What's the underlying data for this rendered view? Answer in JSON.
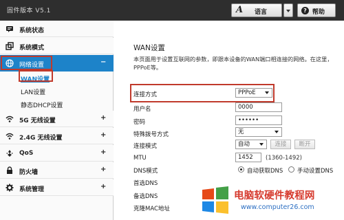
{
  "header": {
    "firmware_version": "固件版本 V5.1",
    "language_glyph": "A",
    "language_label": "语言",
    "help_label": "帮助"
  },
  "sidebar": {
    "items": [
      {
        "label": "系统状态",
        "icon": "status-icon"
      },
      {
        "label": "系统模式",
        "icon": "mode-icon"
      },
      {
        "label": "网络设置",
        "icon": "globe-icon",
        "toggle": "−"
      },
      {
        "label": "5G 无线设置",
        "icon": "wifi-icon",
        "toggle": "+"
      },
      {
        "label": "2.4G 无线设置",
        "icon": "wifi-icon",
        "toggle": "+"
      },
      {
        "label": "QoS",
        "icon": "qos-icon",
        "toggle": "+"
      },
      {
        "label": "防火墙",
        "icon": "lock-icon",
        "toggle": "+"
      },
      {
        "label": "系统管理",
        "icon": "gear-icon",
        "toggle": "+"
      }
    ],
    "subitems": [
      {
        "label": "WAN设置"
      },
      {
        "label": "LAN设置"
      },
      {
        "label": "静态DHCP设置"
      }
    ]
  },
  "main": {
    "title": "WAN设置",
    "description_line1": "本页面用于设置互联网的参数，即跟本设备的WAN端口相连接的网络。在这里，",
    "description_line2": "PPPoE等。",
    "connection_type_label": "连接方式",
    "connection_type_value": "PPPoE",
    "username_label": "用户名",
    "username_value": "0000",
    "password_label": "密码",
    "password_value": "••••••",
    "dial_mode_label": "特殊拨号方式",
    "dial_mode_value": "无",
    "connect_mode_label": "连接模式",
    "connect_mode_value": "自动",
    "connect_button": "连接",
    "disconnect_button": "断开",
    "mtu_label": "MTU",
    "mtu_value": "1452",
    "mtu_hint": "(1360-1492)",
    "dns_mode_label": "DNS模式",
    "dns_auto_label": "自动获取DNS",
    "dns_manual_label": "手动设置DNS",
    "primary_dns_label": "首选DNS",
    "secondary_dns_label": "备选DNS",
    "clone_mac_label": "克隆MAC地址"
  },
  "watermark": {
    "text": "电脑软硬件教程网",
    "url": "www.computer26.com",
    "colors": [
      "#e64a19",
      "#43a047",
      "#1e88e5",
      "#fbc02d"
    ]
  }
}
